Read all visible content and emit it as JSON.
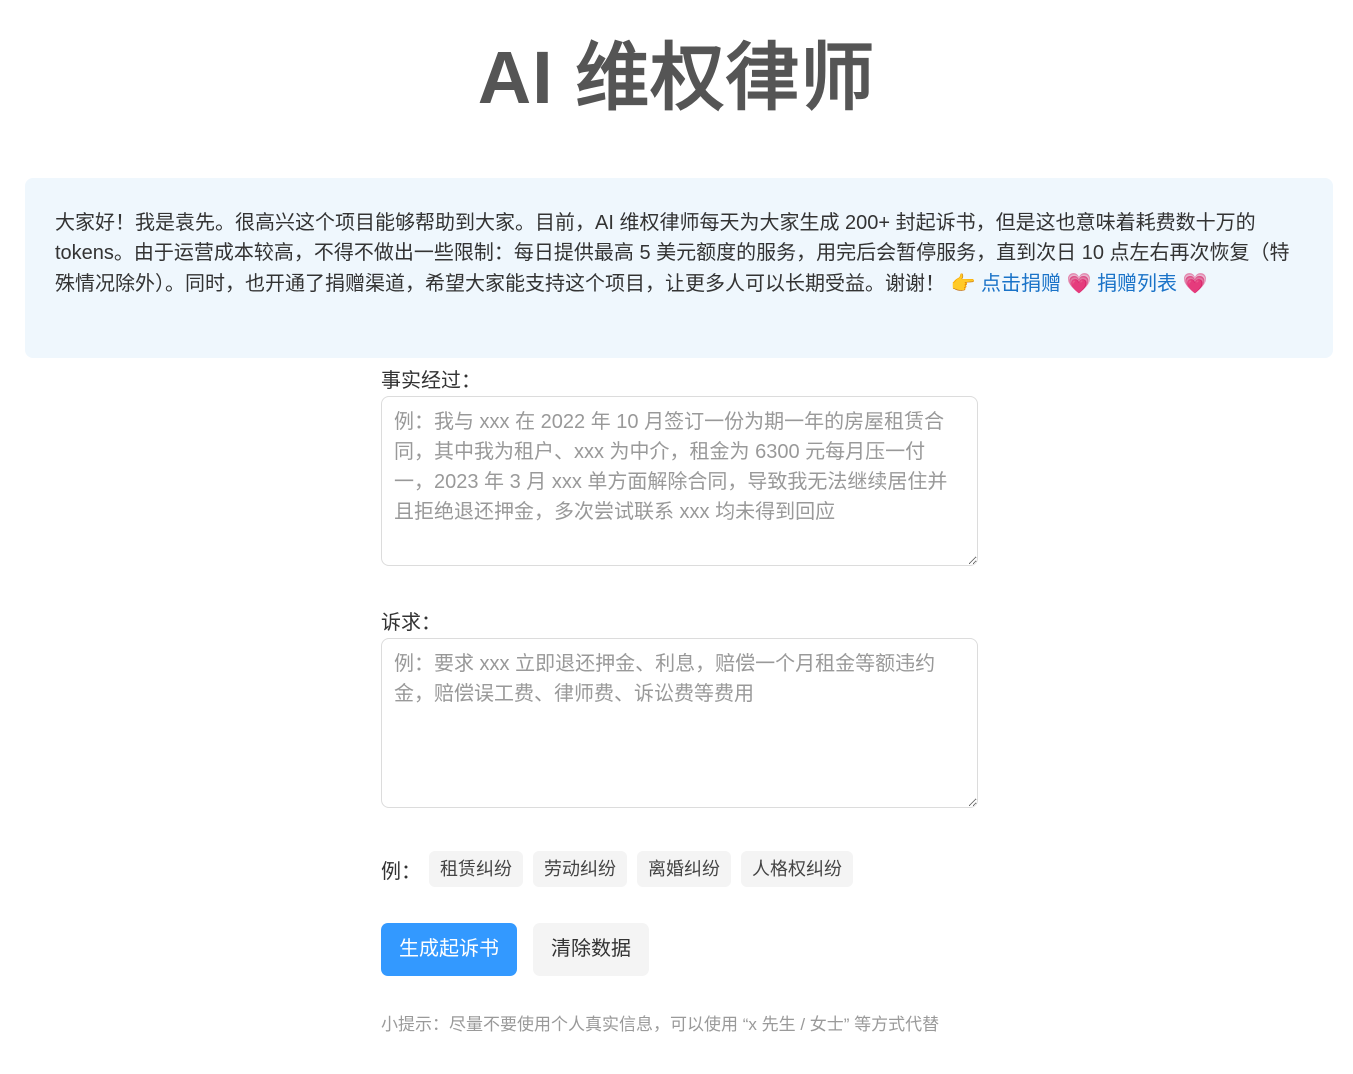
{
  "page": {
    "title": "AI 维权律师"
  },
  "notice": {
    "text": "大家好！我是袁先。很高兴这个项目能够帮助到大家。目前，AI 维权律师每天为大家生成 200+ 封起诉书，但是这也意味着耗费数十万的 tokens。由于运营成本较高，不得不做出一些限制：每日提供最高 5 美元额度的服务，用完后会暂停服务，直到次日 10 点左右再次恢复（特殊情况除外）。同时，也开通了捐赠渠道，希望大家能支持这个项目，让更多人可以长期受益。谢谢！",
    "point_emoji": "👉",
    "donate_link": "点击捐赠",
    "heart_emoji": "💗",
    "donor_list_link": "捐赠列表",
    "link_color": "#1a73c8"
  },
  "form": {
    "facts_label": "事实经过：",
    "facts_value": "",
    "facts_placeholder": "例：我与 xxx 在 2022 年 10 月签订一份为期一年的房屋租赁合同，其中我为租户、xxx 为中介，租金为 6300 元每月压一付一，2023 年 3 月 xxx 单方面解除合同，导致我无法继续居住并且拒绝退还押金，多次尝试联系 xxx 均未得到回应",
    "claims_label": "诉求：",
    "claims_value": "",
    "claims_placeholder": "例：要求 xxx 立即退还押金、利息，赔偿一个月租金等额违约金，赔偿误工费、律师费、诉讼费等费用"
  },
  "examples": {
    "label": "例：",
    "tags": [
      "租赁纠纷",
      "劳动纠纷",
      "离婚纠纷",
      "人格权纠纷"
    ]
  },
  "actions": {
    "generate_label": "生成起诉书",
    "clear_label": "清除数据",
    "primary_color": "#3399ff"
  },
  "tip": {
    "text": "小提示：尽量不要使用个人真实信息，可以使用 “x 先生 / 女士” 等方式代替"
  }
}
